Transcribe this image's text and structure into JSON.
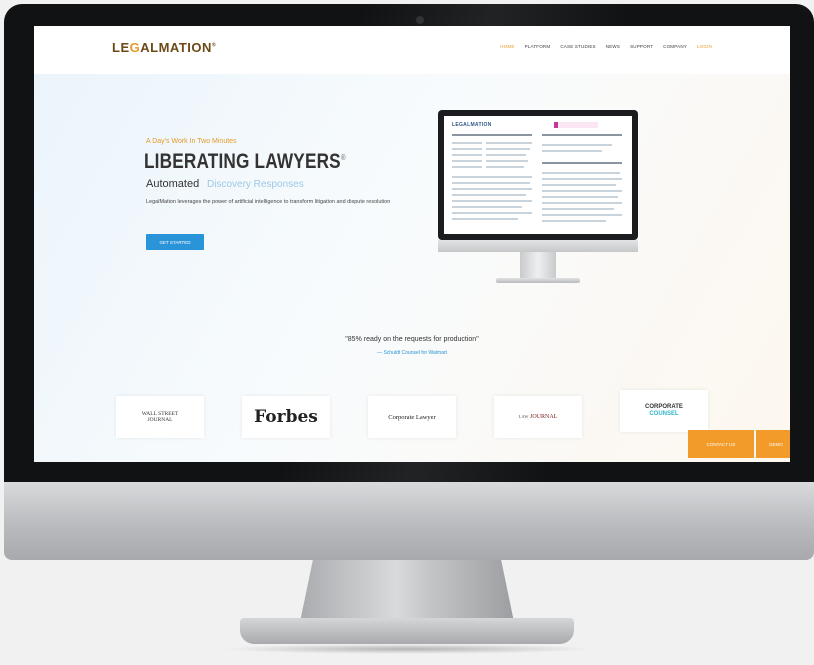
{
  "site": {
    "logo_prefix": "LE",
    "logo_accent": "G",
    "logo_suffix": "ALMATION",
    "logo_mark": "®"
  },
  "nav": {
    "items": [
      {
        "label": "HOME",
        "active": true
      },
      {
        "label": "PLATFORM",
        "active": false
      },
      {
        "label": "CASE STUDIES",
        "active": false
      },
      {
        "label": "NEWS",
        "active": false
      },
      {
        "label": "SUPPORT",
        "active": false
      },
      {
        "label": "COMPANY",
        "active": false
      },
      {
        "label": "LOGIN",
        "active": false
      }
    ]
  },
  "hero": {
    "tagline": "A Day's Work In Two Minutes",
    "title": "LIBERATING LAWYERS",
    "title_mark": "®",
    "subtitle_prefix": "Automated",
    "subtitle_suffix": "Discovery Responses",
    "description": "LegalMation leverages the power of artificial intelligence to transform litigation and dispute resolution",
    "cta_label": "GET STARTED"
  },
  "preview": {
    "logo": "LEGALMATION"
  },
  "testimonial": {
    "quote": "\"85% ready on the requests for production\"",
    "author": "— Schuldt Counsel for Walmart"
  },
  "press": {
    "wsj_line1": "WALL STREET",
    "wsj_line2": "JOURNAL",
    "forbes": "Forbes",
    "corporate_lawyer": "Corporate Lawyer",
    "law_journal_prefix": "LAW",
    "law_journal": "JOURNAL",
    "cc_line1": "CORPORATE",
    "cc_line2": "COUNSEL"
  },
  "floating": {
    "contact_label": "CONTACT US",
    "second_label": "DEMO"
  },
  "colors": {
    "accent_orange": "#e59a2b",
    "brand_blue": "#2a94d8",
    "bezel": "#111214"
  }
}
